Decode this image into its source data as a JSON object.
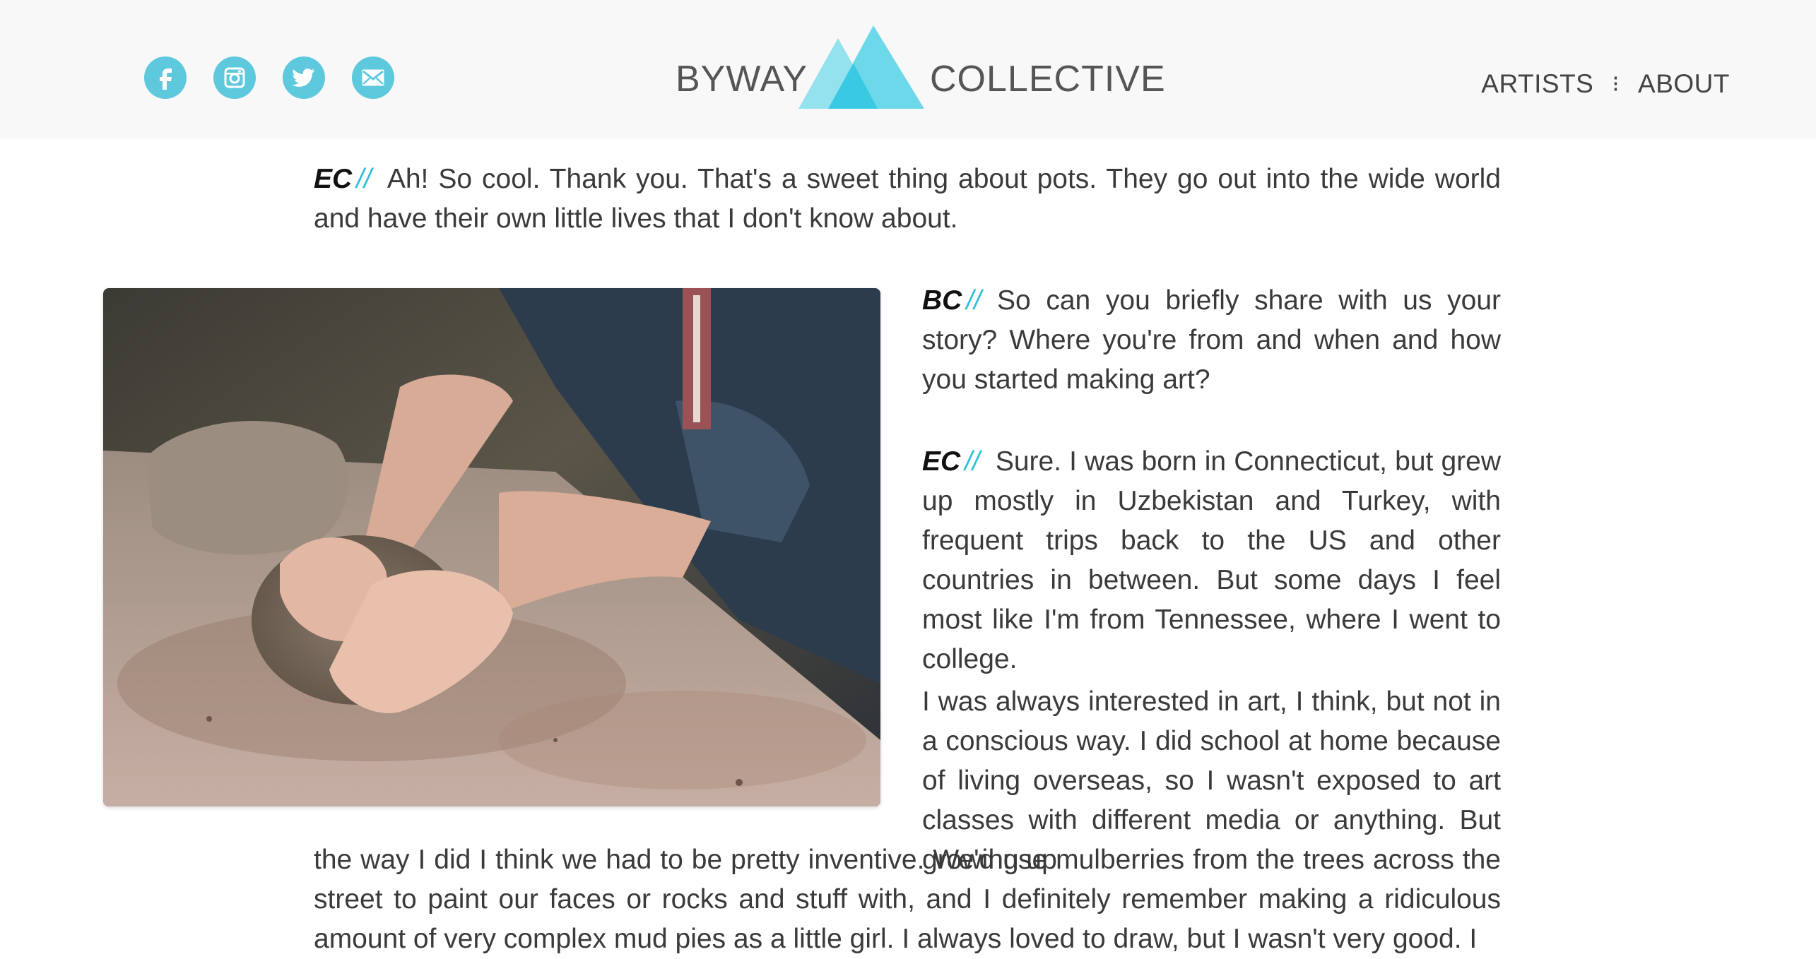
{
  "header": {
    "social": [
      {
        "icon": "facebook-icon",
        "label": "f"
      },
      {
        "icon": "instagram-icon",
        "label": ""
      },
      {
        "icon": "twitter-icon",
        "label": ""
      },
      {
        "icon": "mail-icon",
        "label": ""
      }
    ],
    "logo": {
      "left_word": "BYWAY",
      "right_word": "COLLECTIVE"
    },
    "nav": {
      "artists": "ARTISTS",
      "separator": "⁝",
      "about": "ABOUT"
    }
  },
  "colors": {
    "accent": "#2ec0d8",
    "icon_bg": "#5ec8dd",
    "header_bg": "#f8f8f8"
  },
  "interview": {
    "p1": {
      "speaker": "EC",
      "slashes": "//",
      "text": "Ah! So cool. Thank you. That's a sweet thing about pots. They go out into the wide world and have their own little lives that I don't know about."
    },
    "p2": {
      "speaker": "BC",
      "slashes": "//",
      "text": "So can you briefly share with us your story? Where you're from and when and how you started making art?"
    },
    "p3": {
      "speaker": "EC",
      "slashes": "//",
      "text": "Sure. I was born in Connecticut, but grew up mostly in Uzbekistan and Turkey, with frequent trips back to the US and other countries in between. But some days I feel most like I'm from Tennessee, where I went to college."
    },
    "p4": {
      "text": "I was always interested in art, I think, but not in a conscious way. I did school at home because of living overseas, so I wasn't exposed to art classes with different media or anything. But growing up"
    },
    "p5": {
      "text": "the way I did I think we had to be pretty inventive. We'd use mulberries from the trees across the street to paint our faces or rocks and stuff with, and I definitely remember making a ridiculous amount of very complex mud pies as a little girl. I always loved to draw, but I wasn't very good. I"
    }
  }
}
